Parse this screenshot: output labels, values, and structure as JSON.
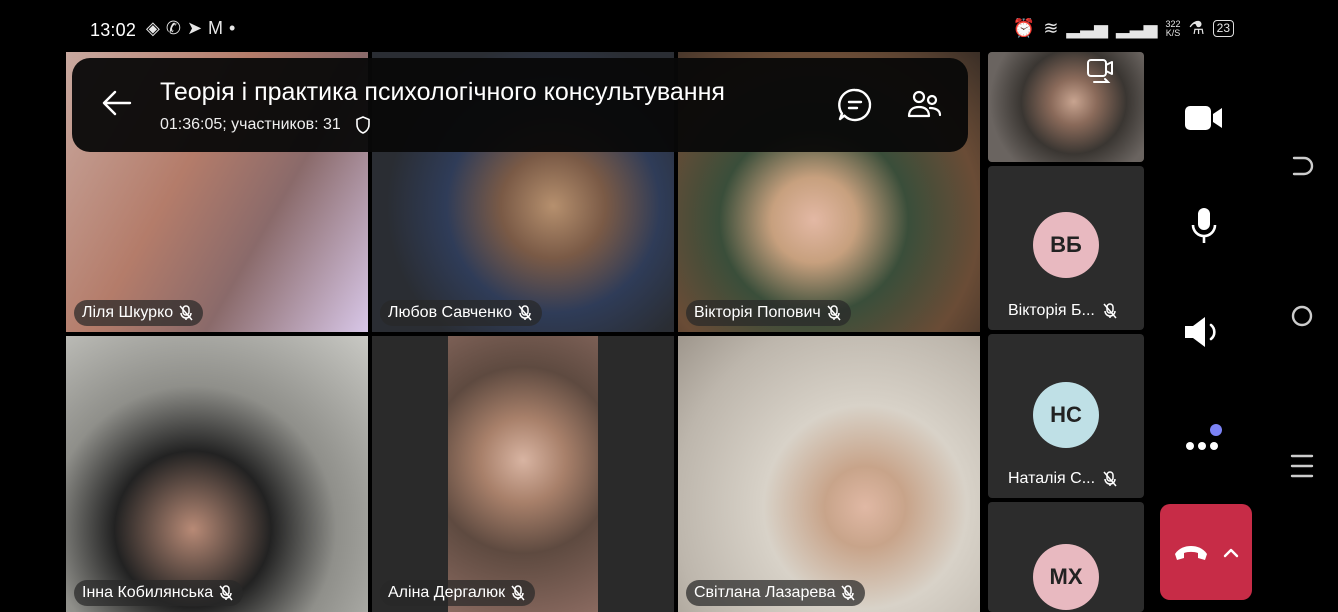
{
  "status_bar": {
    "time": "13:02",
    "left_icons": [
      "location-icon",
      "phone-icon",
      "telegram-icon",
      "gmail-icon",
      "dot-icon"
    ],
    "right_icons": [
      "alarm-icon",
      "wifi-icon",
      "signal-icon",
      "signal-icon"
    ],
    "net_speed_value": "322",
    "net_speed_unit": "K/S",
    "battery": "23"
  },
  "meeting": {
    "title": "Теорія  і практика психологічного консультування",
    "subtitle": "01:36:05; участников: 31"
  },
  "participants": [
    {
      "name": "Ліля Шкурко",
      "bg": "#a88c7a"
    },
    {
      "name": "Любов Савченко",
      "bg": "#3b4046"
    },
    {
      "name": "Вікторія Попович",
      "bg": "#5a4a3c"
    },
    {
      "name": "Інна Кобилянська",
      "bg": "#9a9a96"
    },
    {
      "name": "Аліна Дергалюк",
      "bg": "#8a7a6e"
    },
    {
      "name": "Світлана Лазарева",
      "bg": "#b9b2aa"
    }
  ],
  "side_participants": [
    {
      "name": "Вікторія Б...",
      "initials": "ВБ",
      "avatar_color": "#e8b9c0"
    },
    {
      "name": "Наталія С...",
      "initials": "НС",
      "avatar_color": "#bfe0e6"
    },
    {
      "initials": "МХ",
      "avatar_color": "#e8b9c0"
    }
  ],
  "controls": [
    "camera-icon",
    "microphone-icon",
    "speaker-icon",
    "more-icon",
    "hang-up-icon"
  ],
  "colors": {
    "hangup": "#c72c47",
    "notification_dot": "#7c83f5"
  }
}
